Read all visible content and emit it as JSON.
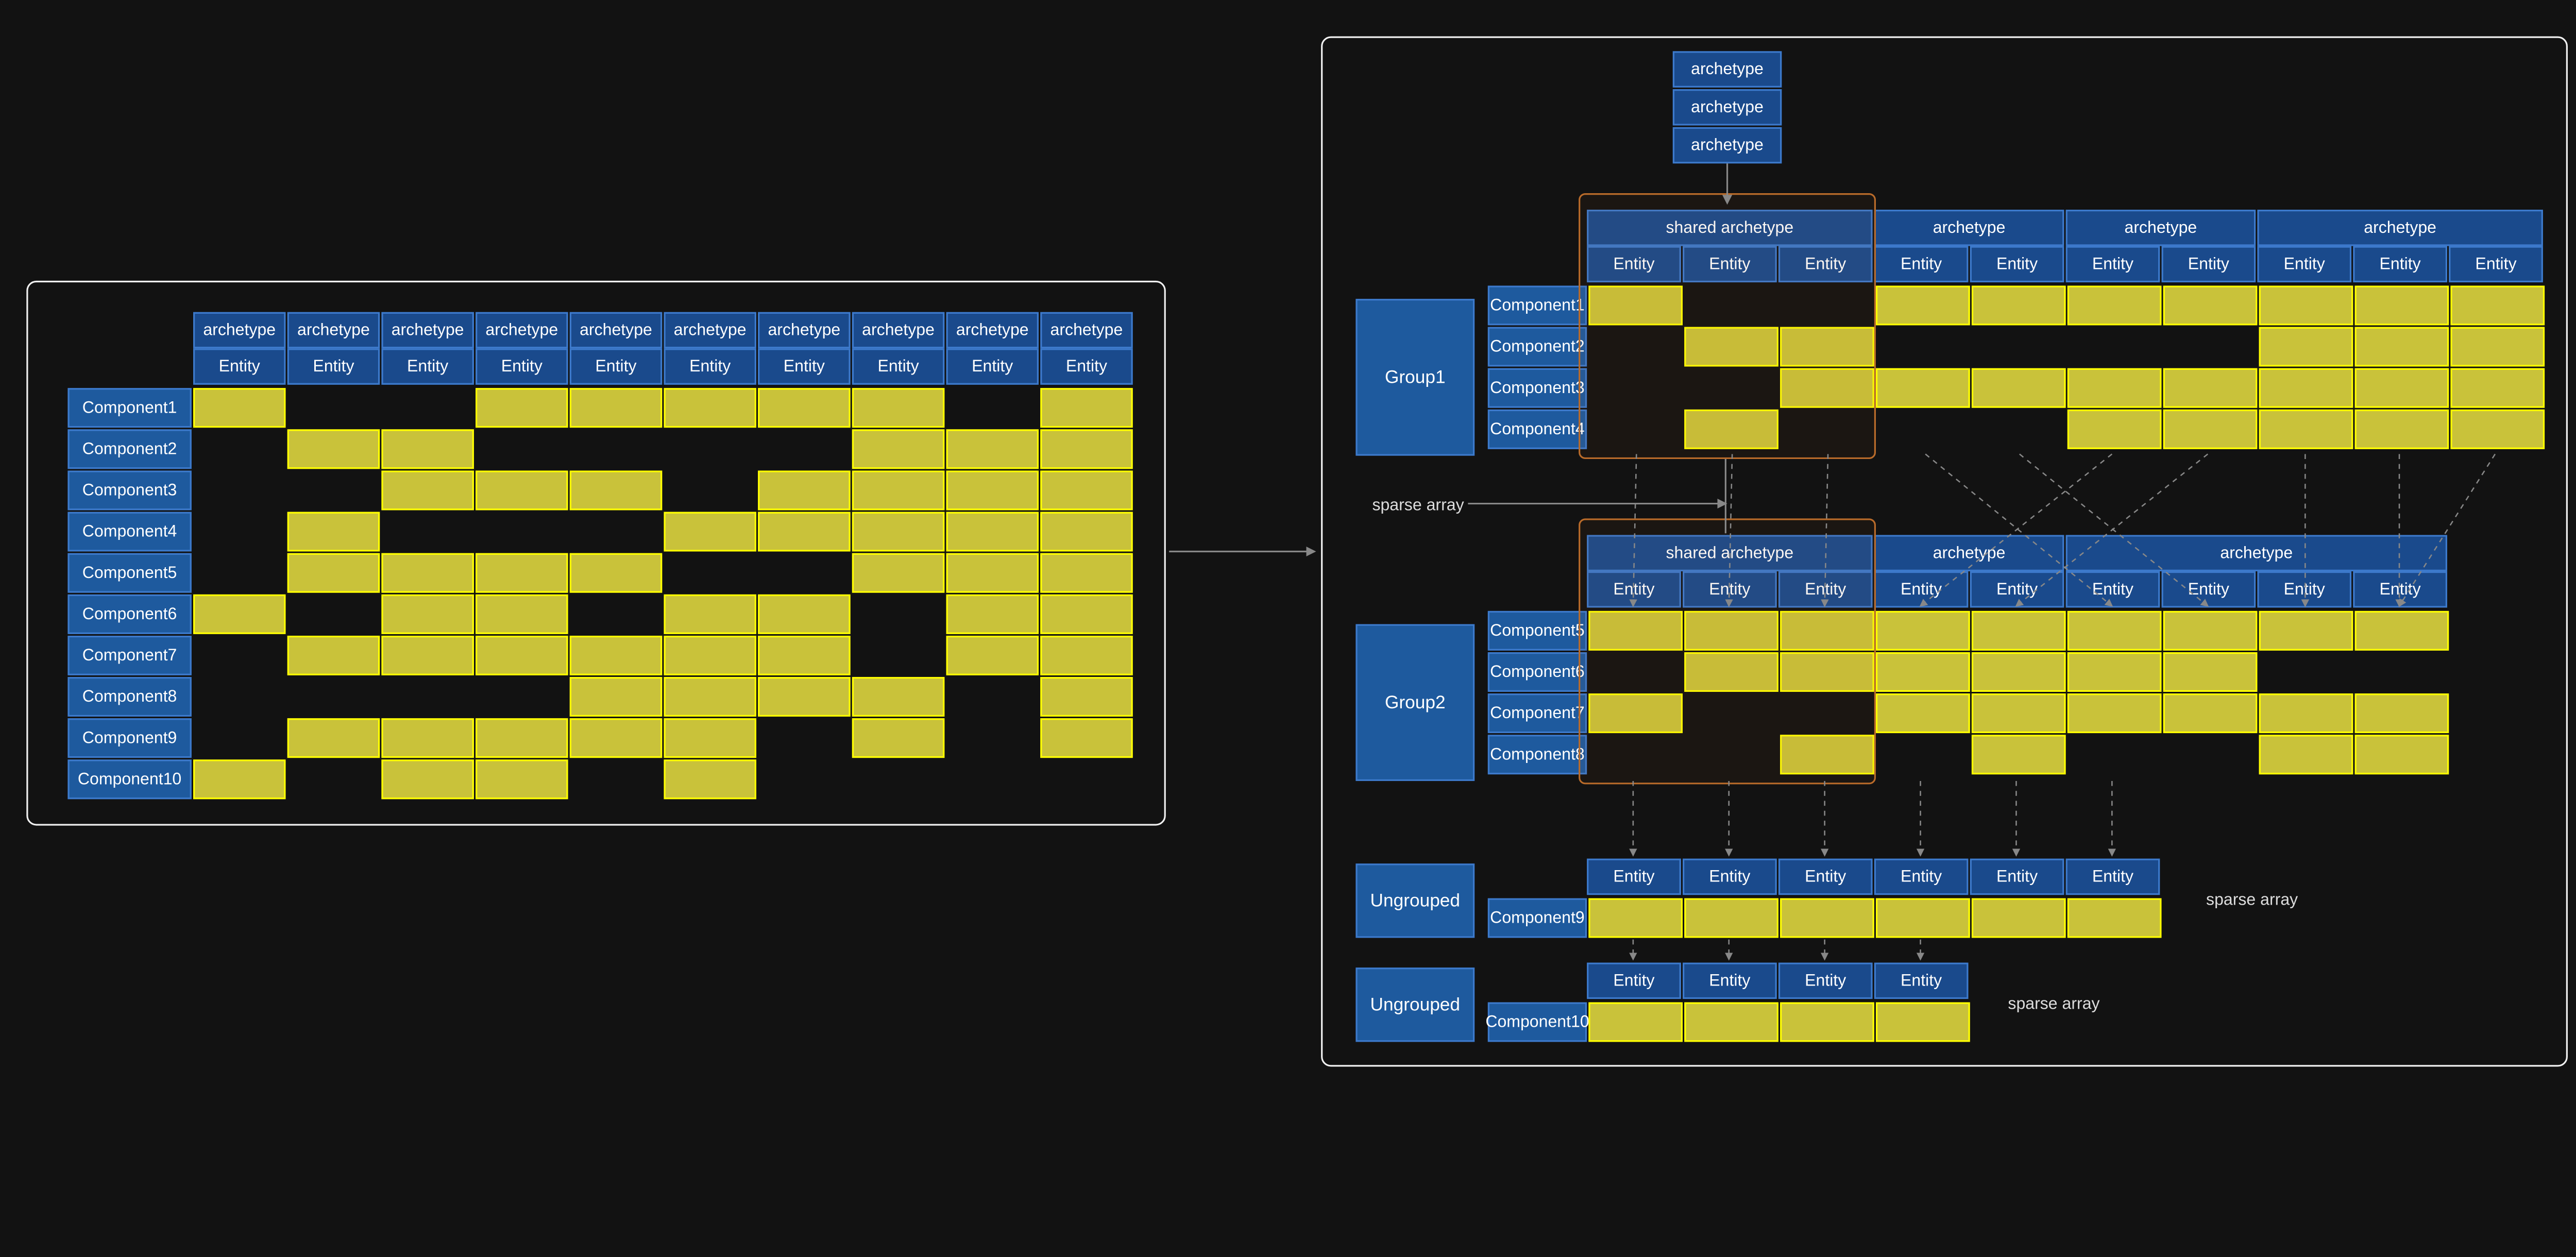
{
  "labels": {
    "archetype": "archetype",
    "shared_archetype": "shared archetype",
    "entity": "Entity",
    "group1": "Group1",
    "group2": "Group2",
    "ungrouped": "Ungrouped",
    "sparse_array": "sparse array"
  },
  "left": {
    "archetype_count": 10,
    "components": [
      "Component1",
      "Component2",
      "Component3",
      "Component4",
      "Component5",
      "Component6",
      "Component7",
      "Component8",
      "Component9",
      "Component10"
    ],
    "matrix": [
      [
        1,
        0,
        0,
        1,
        1,
        1,
        1,
        1,
        0,
        1
      ],
      [
        0,
        1,
        1,
        0,
        0,
        0,
        0,
        1,
        1,
        1
      ],
      [
        0,
        0,
        1,
        1,
        1,
        0,
        1,
        1,
        1,
        1
      ],
      [
        0,
        1,
        0,
        0,
        0,
        1,
        1,
        1,
        1,
        1
      ],
      [
        0,
        1,
        1,
        1,
        1,
        0,
        0,
        1,
        1,
        1
      ],
      [
        1,
        0,
        1,
        1,
        0,
        1,
        1,
        0,
        1,
        1
      ],
      [
        0,
        1,
        1,
        1,
        1,
        1,
        1,
        0,
        1,
        1
      ],
      [
        0,
        0,
        0,
        0,
        1,
        1,
        1,
        1,
        0,
        1
      ],
      [
        0,
        1,
        1,
        1,
        1,
        1,
        0,
        1,
        0,
        1
      ],
      [
        1,
        0,
        1,
        1,
        0,
        1,
        0,
        0,
        0,
        0
      ]
    ]
  },
  "right": {
    "top_archetype_count": 3,
    "group1": {
      "archetype_header": [
        "shared archetype",
        "archetype",
        "archetype",
        "archetype"
      ],
      "shared_cols": 3,
      "other_cols_each": 2,
      "components": [
        "Component1",
        "Component2",
        "Component3",
        "Component4"
      ],
      "matrix": [
        [
          1,
          0,
          0,
          1,
          1,
          1,
          1,
          1,
          1,
          1
        ],
        [
          0,
          1,
          1,
          0,
          0,
          0,
          0,
          1,
          1,
          1
        ],
        [
          0,
          0,
          1,
          1,
          1,
          1,
          1,
          1,
          1,
          1
        ],
        [
          0,
          1,
          0,
          0,
          0,
          1,
          1,
          1,
          1,
          1
        ]
      ]
    },
    "group2": {
      "archetype_header": [
        "shared archetype",
        "archetype",
        "archetype"
      ],
      "shared_cols": 3,
      "other_cols_each": 2,
      "components": [
        "Component5",
        "Component6",
        "Component7",
        "Component8"
      ],
      "matrix": [
        [
          1,
          1,
          1,
          1,
          1,
          1,
          1,
          1,
          1
        ],
        [
          0,
          1,
          1,
          1,
          1,
          1,
          1,
          0,
          0
        ],
        [
          1,
          0,
          0,
          1,
          1,
          1,
          1,
          1,
          1
        ],
        [
          0,
          0,
          1,
          0,
          1,
          0,
          0,
          1,
          1
        ]
      ]
    },
    "ungrouped1": {
      "component": "Component9",
      "entity_count": 6
    },
    "ungrouped2": {
      "component": "Component10",
      "entity_count": 4
    }
  },
  "colors": {
    "background": "#121212",
    "blue_header": "#1a4a8c",
    "blue_border": "#3d7acc",
    "yellow_fill": "#c9c23a",
    "yellow_border": "#ffff00",
    "highlight_border": "#b96b2a"
  }
}
